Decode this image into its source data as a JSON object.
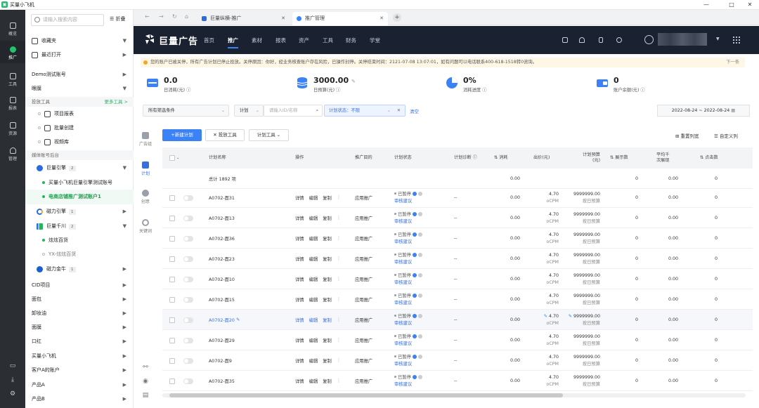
{
  "window": {
    "title": "买量小飞机"
  },
  "rail": [
    {
      "label": "概览"
    },
    {
      "label": "推广"
    },
    {
      "label": "工具"
    },
    {
      "label": "报表"
    },
    {
      "label": "资源"
    },
    {
      "label": "管理"
    }
  ],
  "sidebar": {
    "search_placeholder": "请输入搜索内容",
    "fold_label": "折叠",
    "favorites": "收藏夹",
    "recent": "最近打开",
    "demo_account": "Demo测试账号",
    "eyebrow": "眼膜",
    "tools_group": "投放工具",
    "more_tools": "更多工具 >",
    "tools": [
      "项目报表",
      "批量创建",
      "视频库"
    ],
    "media_group": "媒体账号后台",
    "engines": [
      {
        "name": "巨量引擎",
        "count": "2"
      },
      {
        "name": "磁力引擎",
        "count": "1"
      },
      {
        "name": "巨量千川",
        "count": "2"
      },
      {
        "name": "磁力金牛",
        "count": "1"
      }
    ],
    "engine_accounts": [
      "买量小飞机巨量引擎测试账号",
      "电商店铺推广测试账户1"
    ],
    "qianchuan_accounts": [
      "炫炫百货",
      "YX-炫炫百货"
    ],
    "folders": [
      "CID项目",
      "面包",
      "卸妆油",
      "面膜",
      "口红",
      "买量小飞机",
      "客户A的账户",
      "产品A",
      "产品B"
    ]
  },
  "browser": {
    "tabs": [
      {
        "label": "巨量纵横-推广"
      },
      {
        "label": "推广管理"
      }
    ]
  },
  "topnav": {
    "logo": "巨量广告",
    "items": [
      "首页",
      "推广",
      "素材",
      "报表",
      "资产",
      "工具",
      "财务",
      "学堂"
    ]
  },
  "notice": {
    "text": "您的账户已被关停，所有广告计划已停止投放。关停原因：你好，经业务核查账户存在风险，已操作封停。关停结束时间：2121-07-08 13:07:01，如有问题可以电话联系400-618-1518转0咨询。",
    "next": "下一条"
  },
  "stats": [
    {
      "value": "0.0",
      "label": "日消耗(元)"
    },
    {
      "value": "3000.00",
      "label": "日预算(元)"
    },
    {
      "value": "0%",
      "label": "消耗进度"
    },
    {
      "value": "0",
      "label": "账户余额(元)"
    }
  ],
  "filter": {
    "all_filters": "所有筛选条件",
    "plan_select": "计划",
    "plan_placeholder": "请输入ID/名称",
    "status_tag": "计划状态：不限",
    "clear": "清空",
    "date_from": "2022-08-24",
    "date_to": "2022-08-24"
  },
  "side_tools": [
    "广告组",
    "计划",
    "创意",
    "关键词"
  ],
  "toolbar": {
    "new_plan": "+新建计划",
    "bid": "投放工具",
    "plan_tools": "计划工具",
    "reset_columns": "重置列宽",
    "custom_columns": "自定义列"
  },
  "table": {
    "headers": {
      "name": "计划名称",
      "ops": "操作",
      "goal": "推广目的",
      "status": "计划状态",
      "diag": "计划诊断",
      "cost": "消耗",
      "bid": "出价(元)",
      "budget": "计划预算\n(元)",
      "impr": "展示数",
      "avg": "平均千\n次展现",
      "clicks": "点击数"
    },
    "summary_label": "总计 1892 项",
    "summary_cost": "0.00",
    "summary_impr": "0",
    "summary_avg": "0.00",
    "summary_clicks": "0",
    "op_labels": [
      "详情",
      "编辑",
      "复制"
    ],
    "rows": [
      {
        "name": "A0702-面31",
        "goal": "应用推广",
        "status": "已暂停",
        "advice": "审核建议",
        "diag": "--",
        "cost": "0.00",
        "bid": "4.70",
        "bid_type": "oCPM",
        "budget": "9999999.00",
        "budget_type": "按日预算",
        "impr": "0",
        "avg": "0.00",
        "clicks": "0"
      },
      {
        "name": "A0702-面13",
        "goal": "应用推广",
        "status": "已暂停",
        "advice": "审核建议",
        "diag": "--",
        "cost": "0.00",
        "bid": "4.70",
        "bid_type": "oCPM",
        "budget": "9999999.00",
        "budget_type": "按日预算",
        "impr": "0",
        "avg": "0.00",
        "clicks": "0"
      },
      {
        "name": "A0702-面36",
        "goal": "应用推广",
        "status": "已暂停",
        "advice": "审核建议",
        "diag": "--",
        "cost": "0.00",
        "bid": "4.70",
        "bid_type": "oCPM",
        "budget": "9999999.00",
        "budget_type": "按日预算",
        "impr": "0",
        "avg": "0.00",
        "clicks": "0"
      },
      {
        "name": "A0702-面23",
        "goal": "应用推广",
        "status": "已暂停",
        "advice": "审核建议",
        "diag": "--",
        "cost": "0.00",
        "bid": "4.70",
        "bid_type": "oCPM",
        "budget": "9999999.00",
        "budget_type": "按日预算",
        "impr": "0",
        "avg": "0.00",
        "clicks": "0"
      },
      {
        "name": "A0702-面10",
        "goal": "应用推广",
        "status": "已暂停",
        "advice": "审核建议",
        "diag": "--",
        "cost": "0.00",
        "bid": "4.70",
        "bid_type": "oCPM",
        "budget": "9999999.00",
        "budget_type": "按日预算",
        "impr": "0",
        "avg": "0.00",
        "clicks": "0"
      },
      {
        "name": "A0702-面15",
        "goal": "应用推广",
        "status": "已暂停",
        "advice": "审核建议",
        "diag": "--",
        "cost": "0.00",
        "bid": "4.70",
        "bid_type": "oCPM",
        "budget": "9999999.00",
        "budget_type": "按日预算",
        "impr": "0",
        "avg": "0.00",
        "clicks": "0"
      },
      {
        "name": "A0702-面20",
        "goal": "应用推广",
        "status": "已暂停",
        "advice": "审核建议",
        "diag": "--",
        "cost": "0.00",
        "bid": "4.70",
        "bid_type": "oCPM",
        "budget": "9999999.00",
        "budget_type": "按日预算",
        "impr": "0",
        "avg": "0.00",
        "clicks": "0"
      },
      {
        "name": "A0702-面29",
        "goal": "应用推广",
        "status": "已暂停",
        "advice": "审核建议",
        "diag": "--",
        "cost": "0.00",
        "bid": "4.70",
        "bid_type": "oCPM",
        "budget": "9999999.00",
        "budget_type": "按日预算",
        "impr": "0",
        "avg": "0.00",
        "clicks": "0"
      },
      {
        "name": "A0702-面9",
        "goal": "应用推广",
        "status": "已暂停",
        "advice": "审核建议",
        "diag": "--",
        "cost": "0.00",
        "bid": "4.70",
        "bid_type": "oCPM",
        "budget": "9999999.00",
        "budget_type": "按日预算",
        "impr": "0",
        "avg": "0.00",
        "clicks": "0"
      },
      {
        "name": "A0702-面35",
        "goal": "应用推广",
        "status": "已暂停",
        "advice": "审核建议",
        "diag": "--",
        "cost": "0.00",
        "bid": "4.70",
        "bid_type": "oCPM",
        "budget": "9999999.00",
        "budget_type": "按日预算",
        "impr": "0",
        "avg": "0.00",
        "clicks": "0"
      }
    ]
  },
  "colors": {
    "accent": "#3b82f6",
    "brand_green": "#25b35e",
    "nav_bg": "#1a2232",
    "rail_bg": "#2b2e33"
  }
}
